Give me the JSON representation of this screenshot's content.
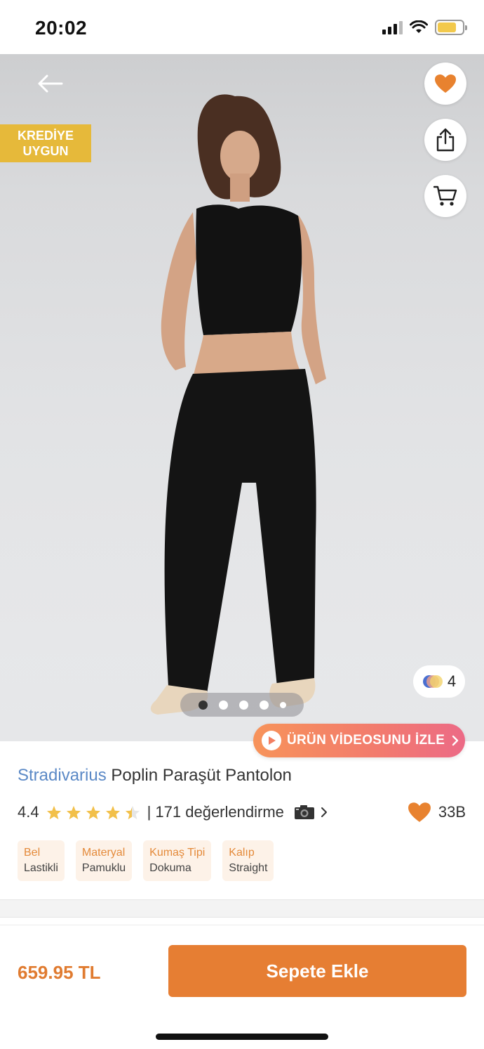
{
  "status_bar": {
    "time": "20:02",
    "battery_level": 0.75,
    "battery_color": "#f2c94c"
  },
  "hero": {
    "credit_badge": {
      "line1": "KREDİYE",
      "line2": "UYGUN",
      "color": "#e6b93a"
    },
    "actions": [
      {
        "name": "favorite",
        "icon": "heart-icon"
      },
      {
        "name": "share",
        "icon": "share-icon"
      },
      {
        "name": "cart",
        "icon": "cart-icon"
      }
    ],
    "color_count": "4",
    "pager": {
      "total": 5,
      "active": 0
    },
    "video_button": {
      "label": "ÜRÜN VİDEOSUNU İZLE"
    }
  },
  "product": {
    "brand": "Stradivarius",
    "name": "Poplin Paraşüt Pantolon",
    "rating": "4.4",
    "rating_stars": 4.4,
    "reviews_text": "| 171 değerlendirme",
    "favorites": "33B",
    "attributes": [
      {
        "key": "Bel",
        "value": "Lastikli"
      },
      {
        "key": "Materyal",
        "value": "Pamuklu"
      },
      {
        "key": "Kumaş Tipi",
        "value": "Dokuma"
      },
      {
        "key": "Kalıp",
        "value": "Straight"
      }
    ]
  },
  "bottom": {
    "price": "659.95 TL",
    "add_to_cart": "Sepete Ekle"
  },
  "colors": {
    "accent": "#e67e33",
    "brand_link": "#5b89c6",
    "star": "#f2c04a",
    "heart": "#e8822f"
  }
}
